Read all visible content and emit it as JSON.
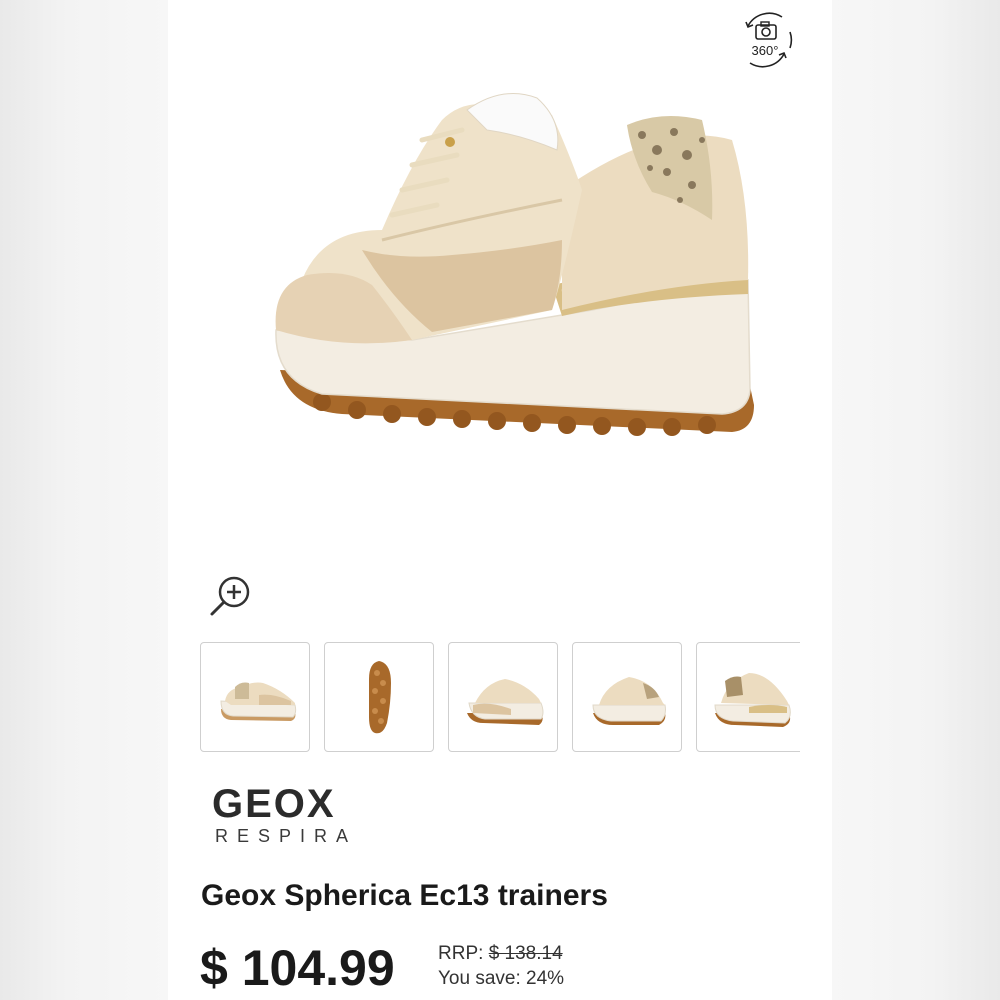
{
  "viewer": {
    "view_360_label": "360°"
  },
  "thumbnails": [
    {
      "view": "side-view"
    },
    {
      "view": "sole-view"
    },
    {
      "view": "three-quarter-front"
    },
    {
      "view": "rear-view"
    },
    {
      "view": "rear-three-quarter"
    }
  ],
  "brand": {
    "name": "GEOX",
    "tagline": "RESPIRA"
  },
  "product": {
    "title": "Geox Spherica Ec13 trainers",
    "price": "$ 104.99",
    "rrp_label": "RRP:",
    "rrp_value": "$ 138.14",
    "savings": "You save: 24%"
  },
  "colors": {
    "upper": "#ecdcc0",
    "suede": "#e6d2b4",
    "sole": "#f3ede2",
    "outsole": "#a8692a",
    "gold_band": "#d9bf86"
  }
}
